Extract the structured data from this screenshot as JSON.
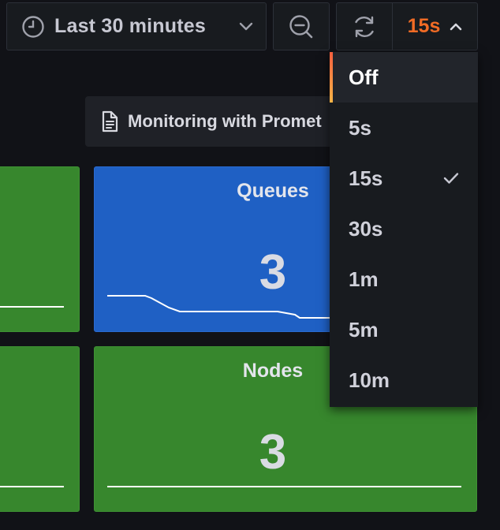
{
  "toolbar": {
    "time_range_label": "Last 30 minutes",
    "refresh_interval": "15s"
  },
  "dashboard_link": {
    "label": "Monitoring with Promet"
  },
  "panels": {
    "queues": {
      "title": "Queues",
      "value": "3"
    },
    "nodes": {
      "title": "Nodes",
      "value": "3"
    }
  },
  "refresh_menu": {
    "items": [
      {
        "label": "Off",
        "highlighted": true,
        "checked": false
      },
      {
        "label": "5s",
        "highlighted": false,
        "checked": false
      },
      {
        "label": "15s",
        "highlighted": false,
        "checked": true
      },
      {
        "label": "30s",
        "highlighted": false,
        "checked": false
      },
      {
        "label": "1m",
        "highlighted": false,
        "checked": false
      },
      {
        "label": "5m",
        "highlighted": false,
        "checked": false
      },
      {
        "label": "10m",
        "highlighted": false,
        "checked": false
      }
    ]
  },
  "colors": {
    "background": "#111217",
    "panel_green": "#37872d",
    "panel_blue": "#1f60c4",
    "accent_orange": "#f06b25"
  },
  "icons": [
    "clock-icon",
    "chevron-down-icon",
    "zoom-out-icon",
    "refresh-icon",
    "chevron-up-icon",
    "document-icon",
    "check-icon"
  ]
}
